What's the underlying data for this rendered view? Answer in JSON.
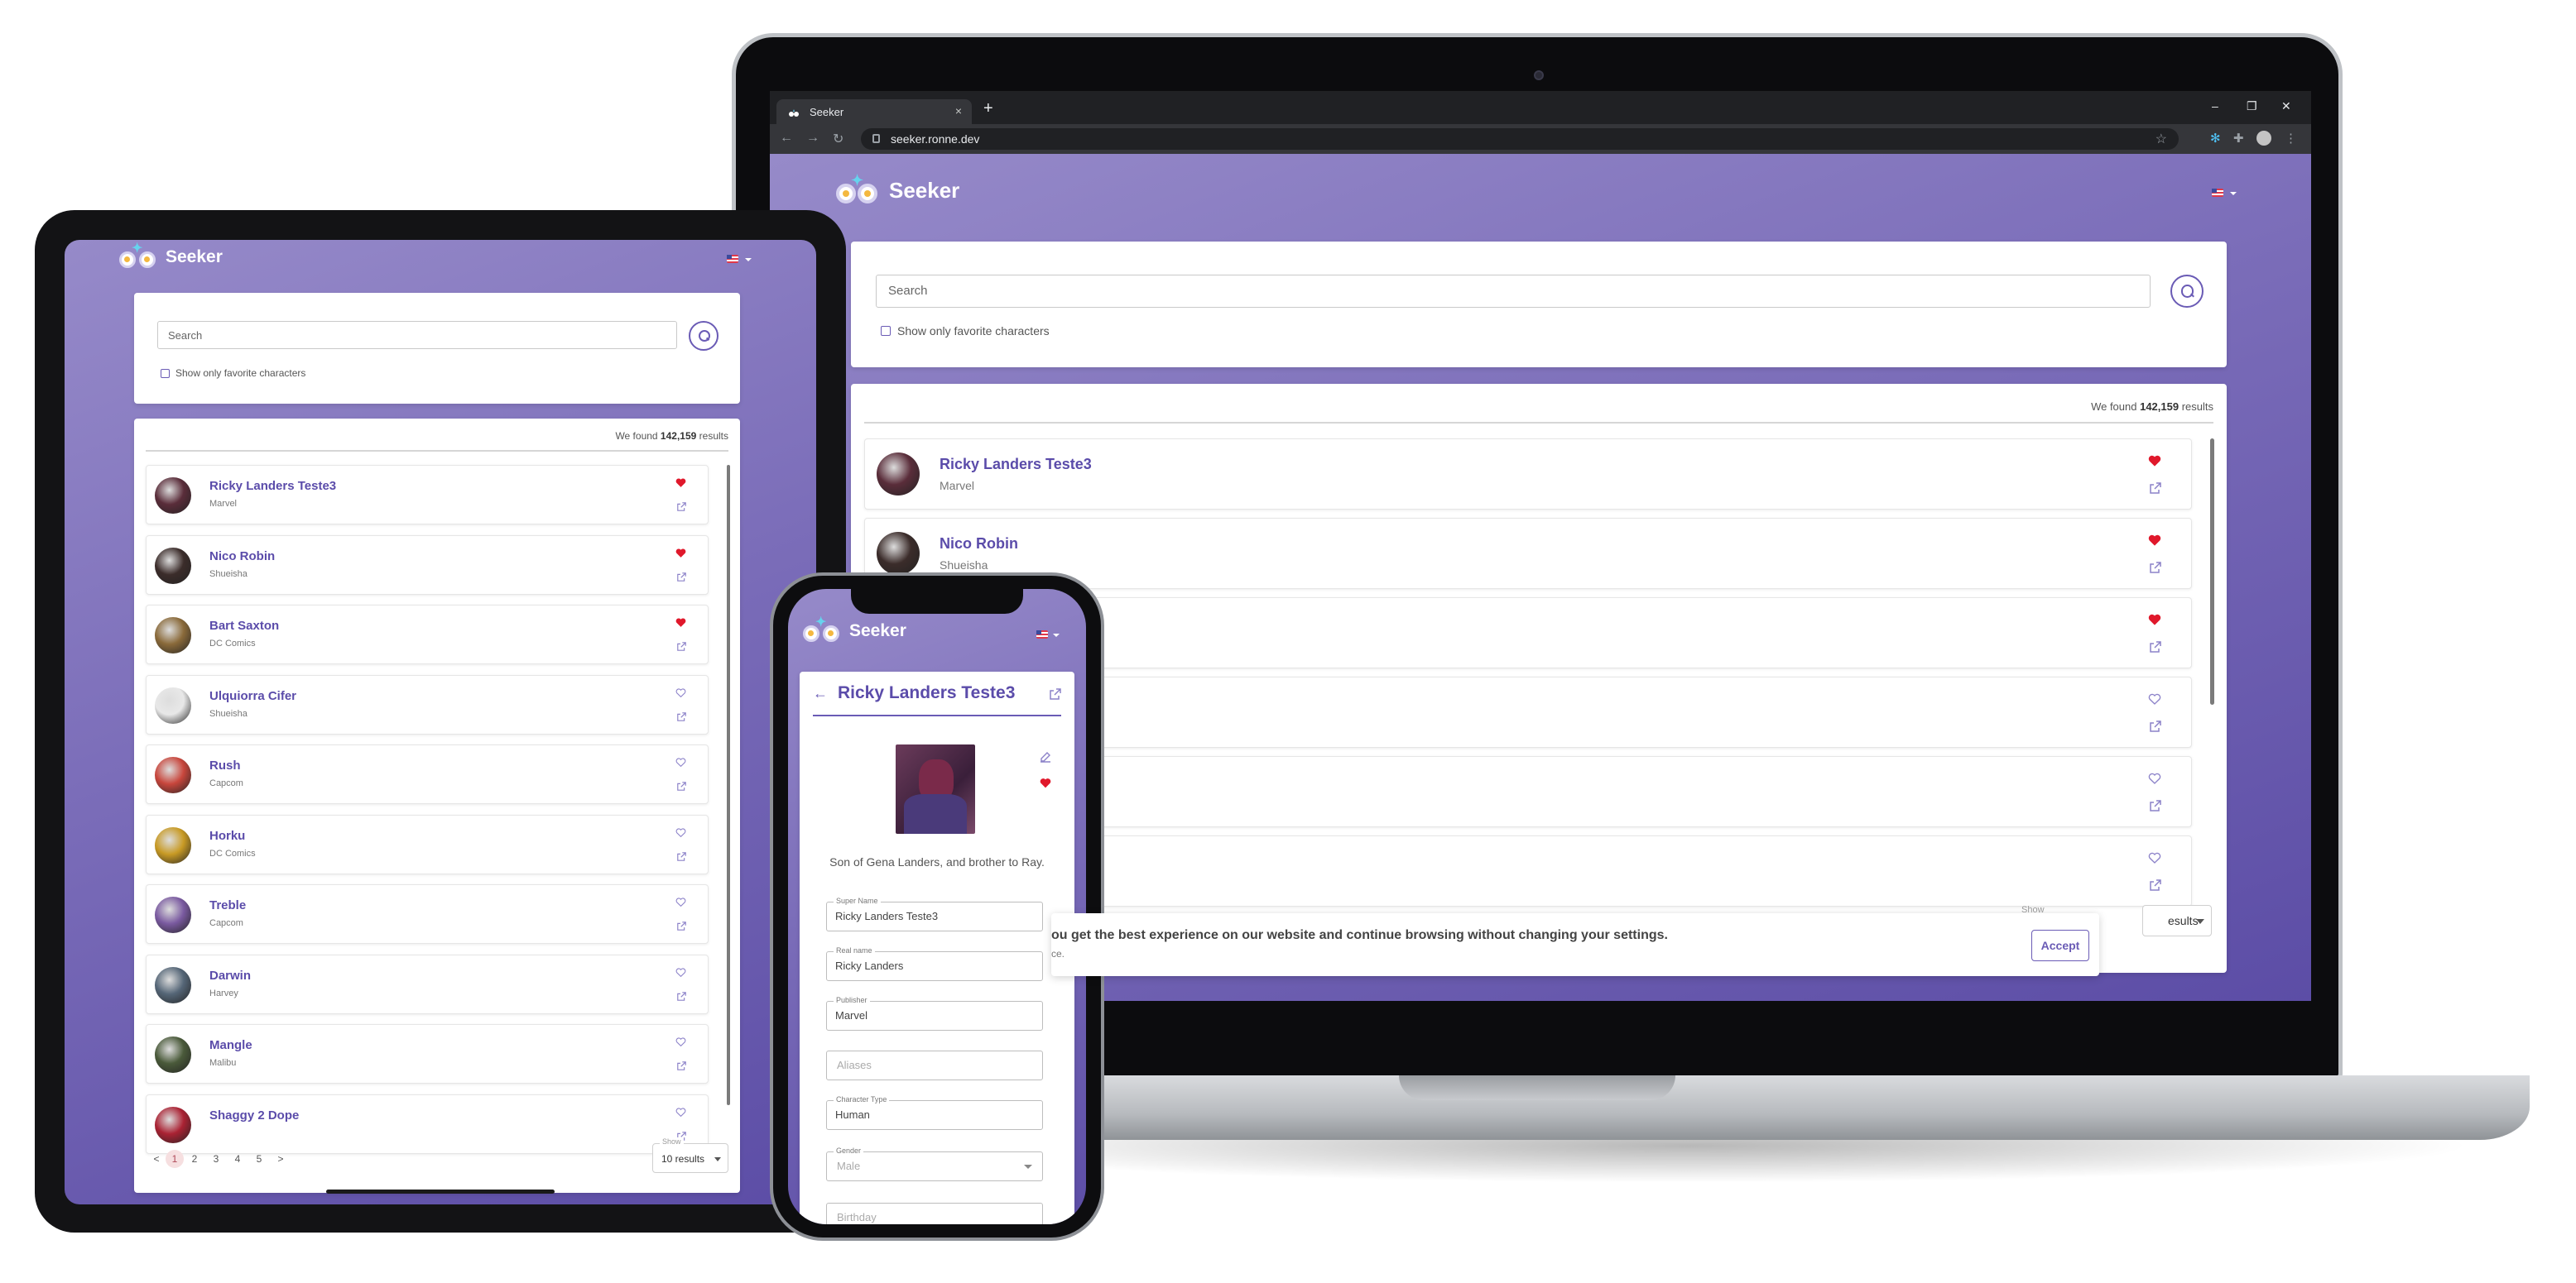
{
  "browser": {
    "tab_title": "Seeker",
    "tab_close": "×",
    "new_tab": "+",
    "window_controls": [
      "–",
      "❐",
      "✕"
    ],
    "url": "seeker.ronne.dev"
  },
  "app": {
    "name": "Seeker",
    "search_placeholder": "Search",
    "favorites_label": "Show only favorite characters",
    "results_prefix": "We found ",
    "results_count": "142,159",
    "results_suffix": " results"
  },
  "colors": {
    "brand_purple": "#6a5bb5",
    "gradient_start": "#968ac9",
    "gradient_end": "#5c4da6",
    "favorite_red": "#e0182b",
    "active_page_bg": "#f6dfe0"
  },
  "characters": [
    {
      "name": "Ricky Landers Teste3",
      "publisher": "Marvel",
      "favorite": true,
      "avatar_color": "#5a2d3a"
    },
    {
      "name": "Nico Robin",
      "publisher": "Shueisha",
      "favorite": true,
      "avatar_color": "#3b2c2a"
    },
    {
      "name": "Bart Saxton",
      "publisher": "DC Comics",
      "favorite": true,
      "avatar_color": "#8a6a3a"
    },
    {
      "name": "Ulquiorra Cifer",
      "publisher": "Shueisha",
      "favorite": false,
      "avatar_color": "#e8e8e8"
    },
    {
      "name": "Rush",
      "publisher": "Capcom",
      "favorite": false,
      "avatar_color": "#c8463c"
    },
    {
      "name": "Horku",
      "publisher": "DC Comics",
      "favorite": false,
      "avatar_color": "#c89a24"
    },
    {
      "name": "Treble",
      "publisher": "Capcom",
      "favorite": false,
      "avatar_color": "#7a5aa0"
    },
    {
      "name": "Darwin",
      "publisher": "Harvey",
      "favorite": false,
      "avatar_color": "#556677"
    },
    {
      "name": "Mangle",
      "publisher": "Malibu",
      "favorite": false,
      "avatar_color": "#4a5a3a"
    },
    {
      "name": "Shaggy 2 Dope",
      "publisher": "",
      "favorite": false,
      "avatar_color": "#aa2233"
    }
  ],
  "pagination": {
    "prev": "<",
    "pages": [
      "1",
      "2",
      "3",
      "4",
      "5"
    ],
    "next": ">",
    "current_page": 1,
    "show_label": "Show",
    "per_page": "10 results",
    "per_page_partial": "esults"
  },
  "cookie": {
    "message": "ou get the best experience on our website and continue browsing without changing your settings.",
    "sub": "ce.",
    "show_label": "Show",
    "accept": "Accept"
  },
  "detail": {
    "title": "Ricky Landers Teste3",
    "back_icon": "←",
    "bio": "Son of Gena Landers, and brother to Ray.",
    "fields": [
      {
        "label": "Super Name",
        "value": "Ricky Landers Teste3",
        "placeholder": ""
      },
      {
        "label": "Real name",
        "value": "Ricky Landers",
        "placeholder": ""
      },
      {
        "label": "Publisher",
        "value": "Marvel",
        "placeholder": ""
      },
      {
        "label": "",
        "value": "",
        "placeholder": "Aliases"
      },
      {
        "label": "Character Type",
        "value": "Human",
        "placeholder": ""
      },
      {
        "label": "Gender",
        "value": "",
        "placeholder": "Male"
      },
      {
        "label": "",
        "value": "",
        "placeholder": "Birthday"
      }
    ]
  }
}
